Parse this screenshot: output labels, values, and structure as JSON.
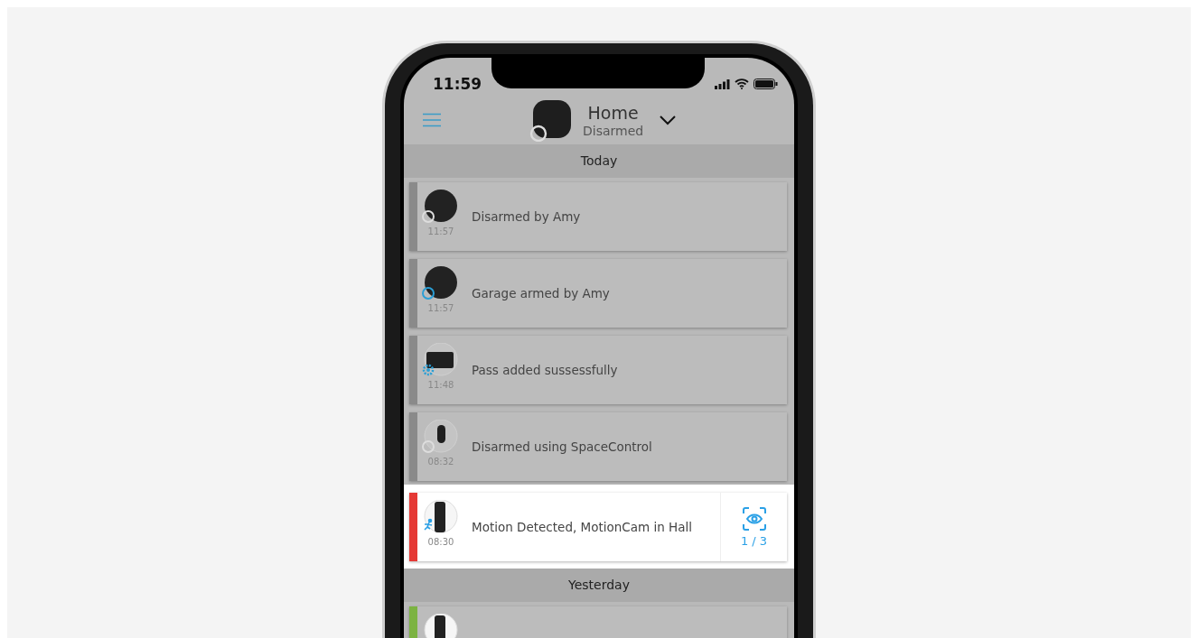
{
  "status_bar": {
    "time": "11:59"
  },
  "header": {
    "title": "Home",
    "subtitle": "Disarmed"
  },
  "feed": [
    {
      "kind": "section",
      "label": "Today"
    },
    {
      "kind": "event",
      "text": "Disarmed by Amy",
      "time": "11:57",
      "color": "#8a8a8a",
      "highlighted": false
    },
    {
      "kind": "event",
      "text": "Garage armed by Amy",
      "time": "11:57",
      "color": "#8a8a8a",
      "highlighted": false
    },
    {
      "kind": "event",
      "text": "Pass added sussessfully",
      "time": "11:48",
      "color": "#8a8a8a",
      "highlighted": false
    },
    {
      "kind": "event",
      "text": "Disarmed using SpaceControl",
      "time": "08:32",
      "color": "#8a8a8a",
      "highlighted": false
    },
    {
      "kind": "event",
      "text": "Motion Detected, MotionCam in Hall",
      "time": "08:30",
      "color": "#e53935",
      "highlighted": true,
      "photos": "1 / 3"
    },
    {
      "kind": "section",
      "label": "Yesterday"
    },
    {
      "kind": "event",
      "color": "#7cb342",
      "highlighted": false
    }
  ]
}
